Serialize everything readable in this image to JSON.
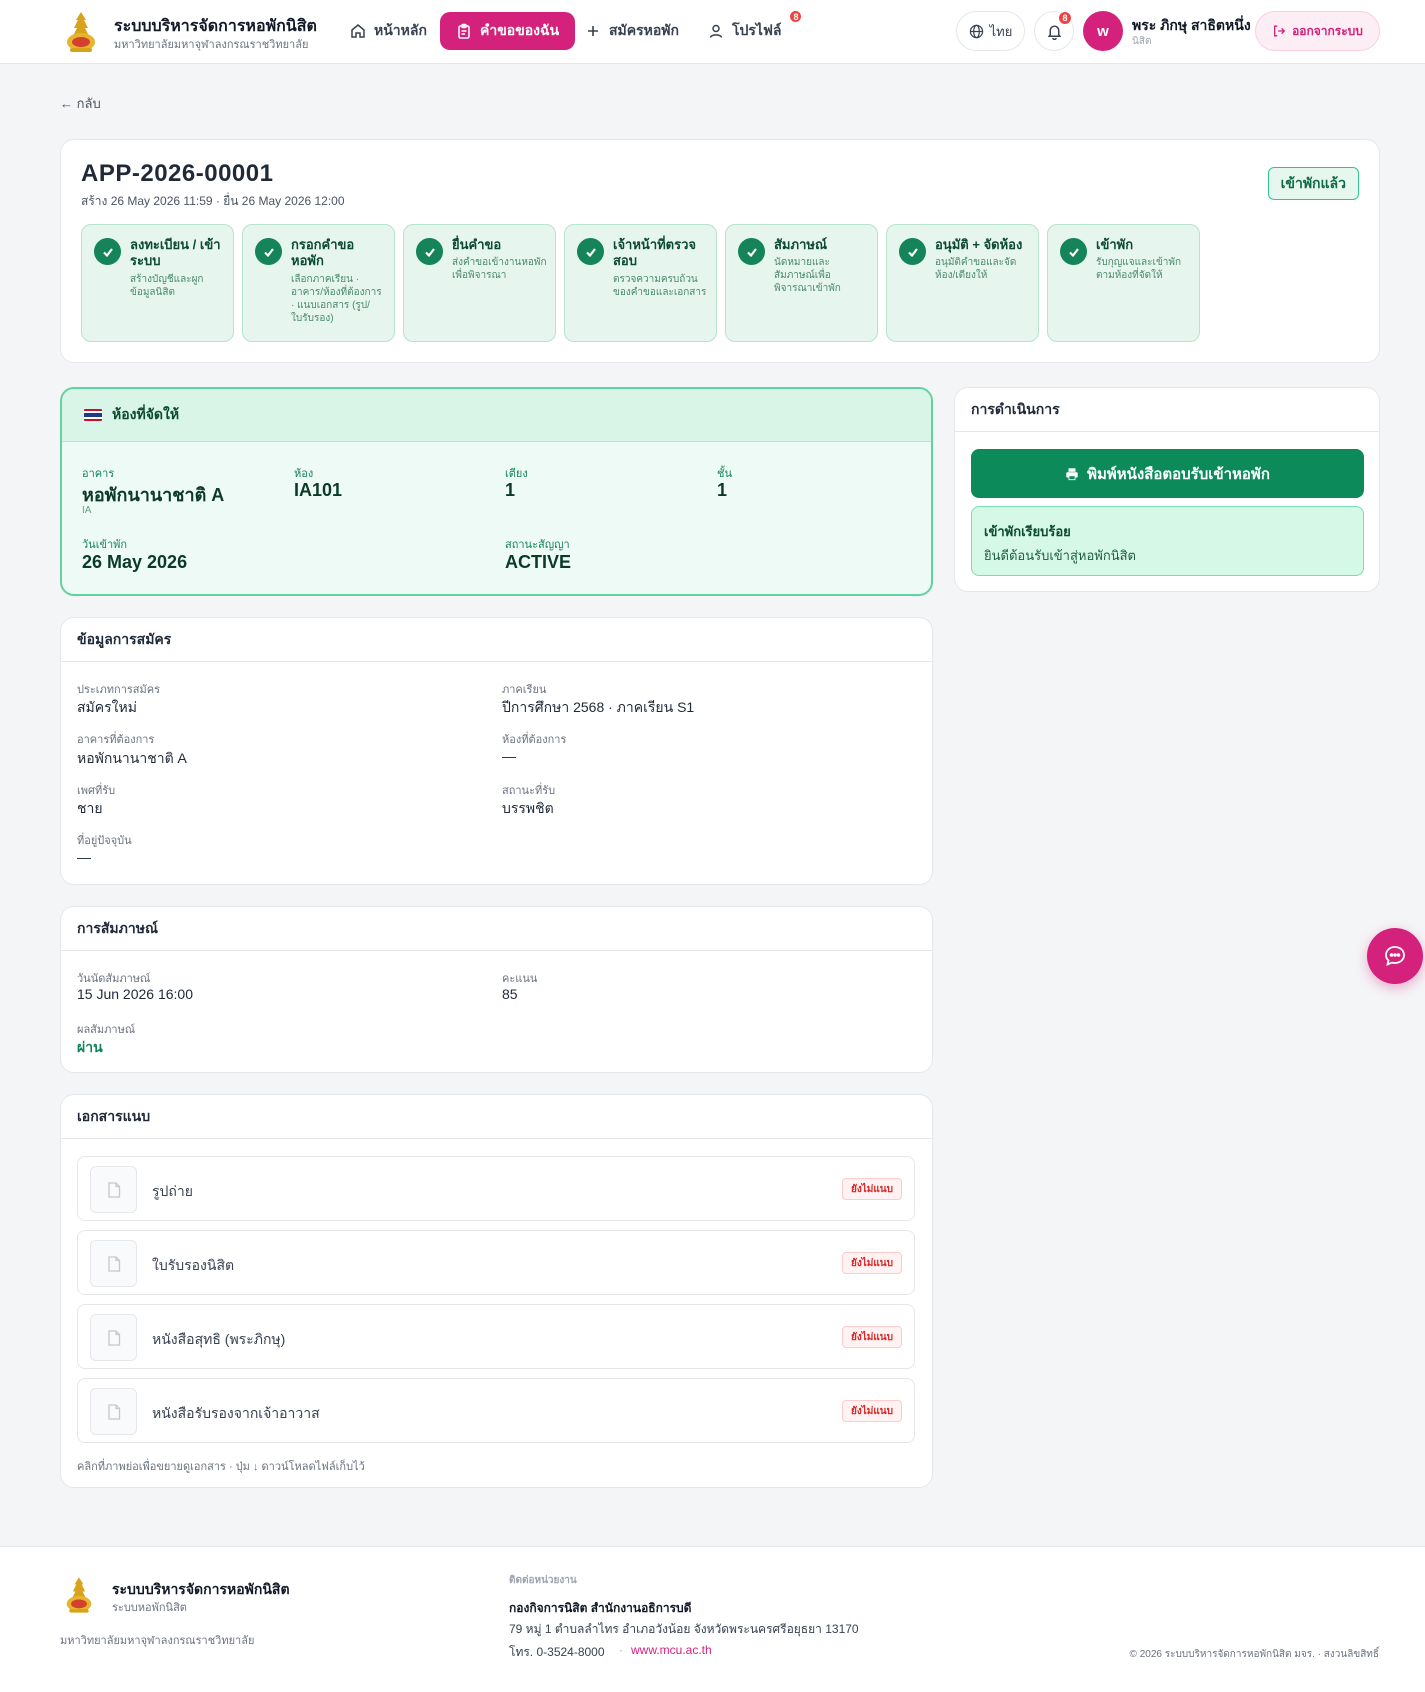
{
  "header": {
    "brand_title": "ระบบบริหารจัดการหอพักนิสิต",
    "brand_sub": "มหาวิทยาลัยมหาจุฬาลงกรณราชวิทยาลัย",
    "nav": {
      "home": "หน้าหลัก",
      "my_requests": "คำขอของฉัน",
      "apply": "สมัครหอพัก",
      "profile": "โปรไฟล์",
      "profile_badge": "8"
    },
    "lang": "ไทย",
    "bell_badge": "8",
    "avatar_letter": "w",
    "user_name": "พระ ภิกษุ สาธิตหนึ่ง",
    "user_role": "นิสิต",
    "logout": "ออกจากระบบ"
  },
  "back": "← กลับ",
  "application": {
    "id": "APP-2026-00001",
    "meta": "สร้าง 26 May 2026 11:59 · ยื่น 26 May 2026 12:00",
    "status": "เข้าพักแล้ว",
    "steps": [
      {
        "title": "ลงทะเบียน / เข้าระบบ",
        "desc": "สร้างบัญชีและผูกข้อมูลนิสิต"
      },
      {
        "title": "กรอกคำขอหอพัก",
        "desc": "เลือกภาคเรียน · อาคาร/ห้องที่ต้องการ · แนบเอกสาร (รูป/ใบรับรอง)"
      },
      {
        "title": "ยื่นคำขอ",
        "desc": "ส่งคำขอเข้างานหอพักเพื่อพิจารณา"
      },
      {
        "title": "เจ้าหน้าที่ตรวจสอบ",
        "desc": "ตรวจความครบถ้วนของคำขอและเอกสาร"
      },
      {
        "title": "สัมภาษณ์",
        "desc": "นัดหมายและสัมภาษณ์เพื่อพิจารณาเข้าพัก"
      },
      {
        "title": "อนุมัติ + จัดห้อง",
        "desc": "อนุมัติคำขอและจัดห้อง/เตียงให้"
      },
      {
        "title": "เข้าพัก",
        "desc": "รับกุญแจและเข้าพักตามห้องที่จัดให้"
      }
    ]
  },
  "room": {
    "title": "ห้องที่จัดให้",
    "building_label": "อาคาร",
    "building": "หอพักนานาชาติ A",
    "building_code": "IA",
    "room_label": "ห้อง",
    "room": "IA101",
    "bed_label": "เตียง",
    "bed": "1",
    "floor_label": "ชั้น",
    "floor": "1",
    "checkin_label": "วันเข้าพัก",
    "checkin": "26 May 2026",
    "contract_label": "สถานะสัญญา",
    "contract": "ACTIVE"
  },
  "applicant": {
    "title": "ข้อมูลการสมัคร",
    "type_label": "ประเภทการสมัคร",
    "type": "สมัครใหม่",
    "term_label": "ภาคเรียน",
    "term": "ปีการศึกษา 2568 · ภาคเรียน S1",
    "building_label": "อาคารที่ต้องการ",
    "building": "หอพักนานาชาติ A",
    "room_label": "ห้องที่ต้องการ",
    "room": "—",
    "gender_label": "เพศที่รับ",
    "gender": "ชาย",
    "status_label": "สถานะที่รับ",
    "status": "บรรพชิต",
    "address_label": "ที่อยู่ปัจจุบัน",
    "address": "—"
  },
  "interview": {
    "title": "การสัมภาษณ์",
    "date_label": "วันนัดสัมภาษณ์",
    "date": "15 Jun 2026 16:00",
    "score_label": "คะแนน",
    "score": "85",
    "result_label": "ผลสัมภาษณ์",
    "result": "ผ่าน"
  },
  "documents": {
    "title": "เอกสารแนบ",
    "items": [
      {
        "name": "รูปถ่าย",
        "status": "ยังไม่แนบ"
      },
      {
        "name": "ใบรับรองนิสิต",
        "status": "ยังไม่แนบ"
      },
      {
        "name": "หนังสือสุทธิ (พระภิกษุ)",
        "status": "ยังไม่แนบ"
      },
      {
        "name": "หนังสือรับรองจากเจ้าอาวาส",
        "status": "ยังไม่แนบ"
      }
    ],
    "hint": "คลิกที่ภาพย่อเพื่อขยายดูเอกสาร · ปุ่ม ↓ ดาวน์โหลดไฟล์เก็บไว้"
  },
  "actions": {
    "title": "การดำเนินการ",
    "print": "พิมพ์หนังสือตอบรับเข้าหอพัก",
    "done_title": "เข้าพักเรียบร้อย",
    "done_sub": "ยินดีต้อนรับเข้าสู่หอพักนิสิต"
  },
  "footer": {
    "title": "ระบบบริหารจัดการหอพักนิสิต",
    "sub": "ระบบหอพักนิสิต",
    "university": "มหาวิทยาลัยมหาจุฬาลงกรณราชวิทยาลัย",
    "contact_label": "ติดต่อหน่วยงาน",
    "org": "กองกิจการนิสิต สำนักงานอธิการบดี",
    "address": "79 หมู่ 1 ตำบลลำไทร อำเภอวังน้อย จังหวัดพระนครศรีอยุธยา 13170",
    "phone": "โทร. 0-3524-8000",
    "website": "www.mcu.ac.th",
    "copyright": "© 2026 ระบบบริหารจัดการหอพักนิสิต มจร. · สงวนลิขสิทธิ์"
  },
  "colors": {
    "brand": "#d4217b",
    "success": "#15845a",
    "success_bg": "#e6f5ee",
    "danger": "#dc2626"
  },
  "icons": [
    "home-icon",
    "clipboard-icon",
    "plus-icon",
    "user-icon",
    "globe-icon",
    "bell-icon",
    "logout-icon",
    "check-icon",
    "flag-icon",
    "printer-icon",
    "file-icon",
    "chat-icon"
  ]
}
